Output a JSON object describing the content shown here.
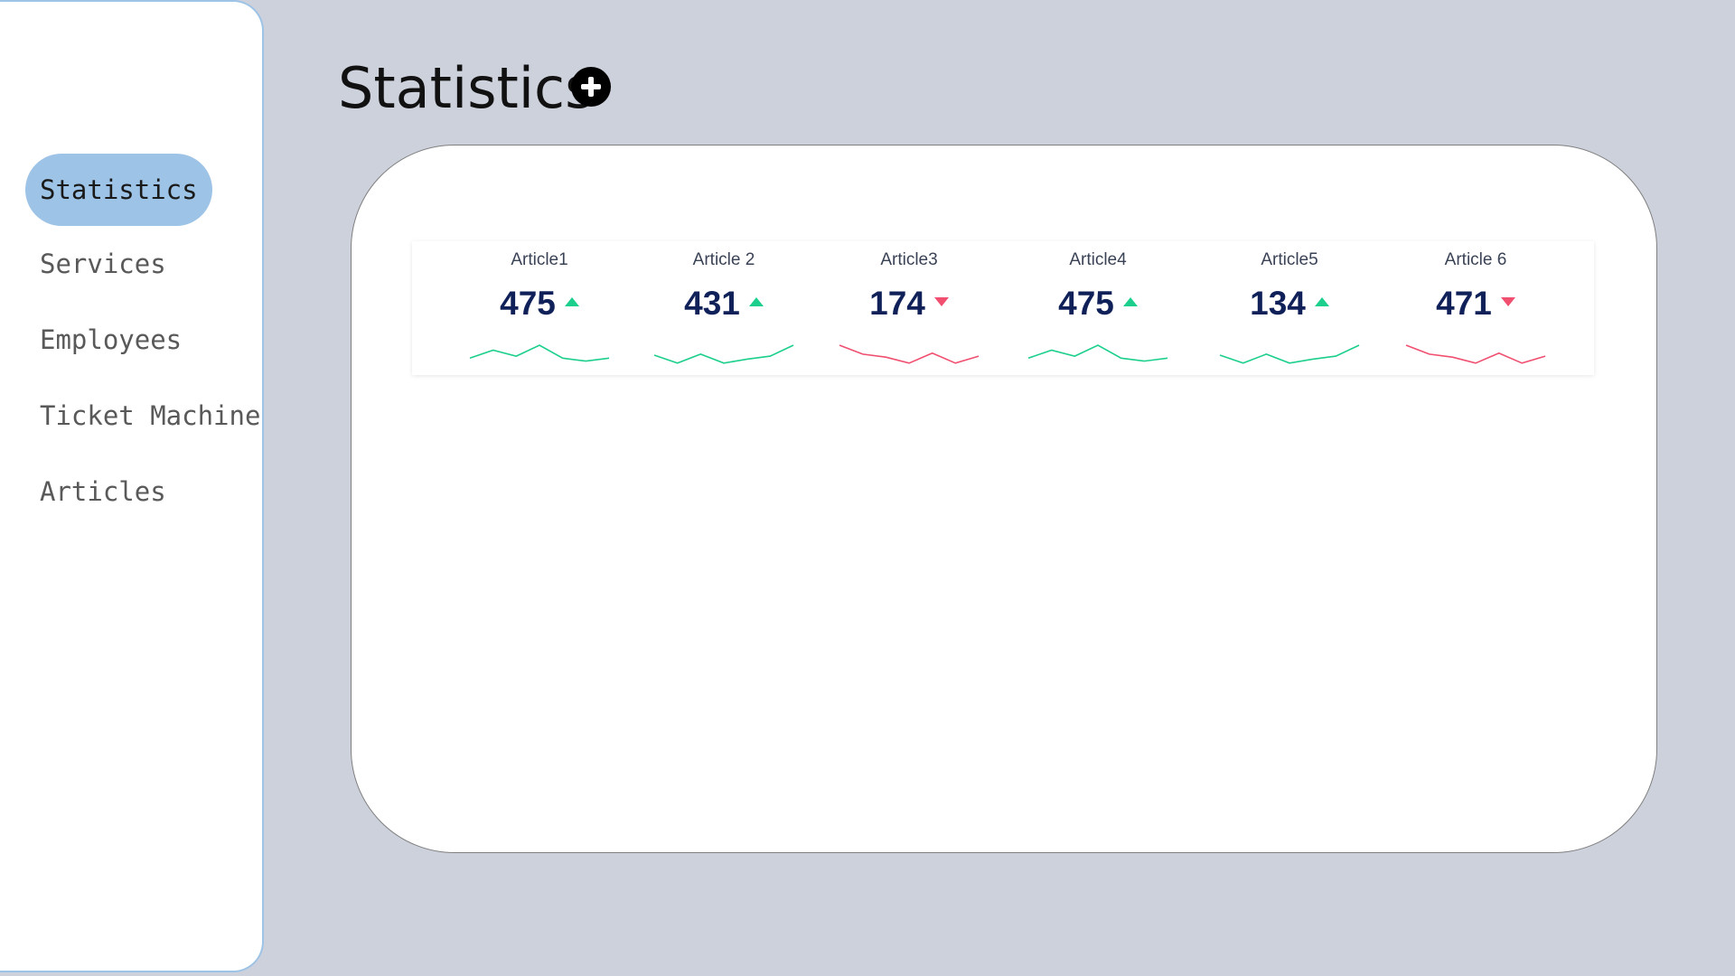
{
  "sidebar": {
    "items": [
      {
        "label": "Statistics",
        "active": true
      },
      {
        "label": "Services",
        "active": false
      },
      {
        "label": "Employees",
        "active": false
      },
      {
        "label": "Ticket Machine",
        "active": false
      },
      {
        "label": "Articles",
        "active": false
      }
    ]
  },
  "header": {
    "title": "Statistics",
    "add_icon": "plus-circle-icon"
  },
  "colors": {
    "background": "#cdd1dc",
    "sidebar_active": "#9dc3e6",
    "trend_up": "#1ccf8c",
    "trend_down": "#f04f6f",
    "kpi_value": "#10215a"
  },
  "kpis": [
    {
      "label": "Article1",
      "value": "475",
      "trend": "up",
      "spark": [
        0.35,
        0.75,
        0.45,
        1.0,
        0.35,
        0.2,
        0.35
      ]
    },
    {
      "label": "Article 2",
      "value": "431",
      "trend": "up",
      "spark": [
        0.5,
        0.1,
        0.55,
        0.1,
        0.3,
        0.45,
        1.0
      ]
    },
    {
      "label": "Article3",
      "value": "174",
      "trend": "down",
      "spark": [
        1.0,
        0.55,
        0.4,
        0.1,
        0.6,
        0.1,
        0.45
      ]
    },
    {
      "label": "Article4",
      "value": "475",
      "trend": "up",
      "spark": [
        0.35,
        0.75,
        0.45,
        1.0,
        0.35,
        0.2,
        0.35
      ]
    },
    {
      "label": "Article5",
      "value": "134",
      "trend": "up",
      "spark": [
        0.5,
        0.1,
        0.55,
        0.1,
        0.3,
        0.45,
        1.0
      ]
    },
    {
      "label": "Article 6",
      "value": "471",
      "trend": "down",
      "spark": [
        1.0,
        0.55,
        0.4,
        0.1,
        0.6,
        0.1,
        0.45
      ]
    }
  ]
}
